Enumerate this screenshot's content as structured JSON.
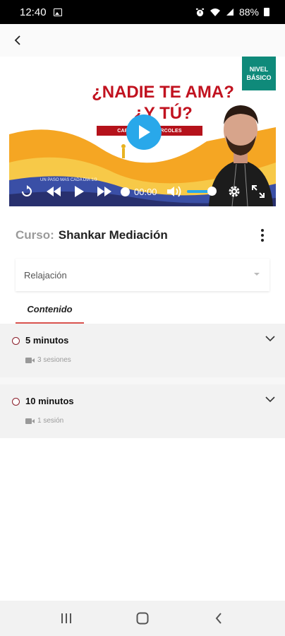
{
  "status": {
    "time": "12:40",
    "battery": "88%",
    "icons": [
      "gallery-icon",
      "alarm-icon",
      "wifi-icon",
      "signal-icon",
      "battery-icon"
    ]
  },
  "video": {
    "badge_line1": "NIVEL",
    "badge_line2": "BÁSICO",
    "title_line1": "¿NADIE TE AMA?",
    "title_line2": "¿Y TÚ?",
    "subtitle": "CAPÍTULO ... MIÉRCOLES",
    "tagline": "UN PASO MÁS CADA DÍA 1/3",
    "time": "00:00",
    "volume": 1.0,
    "colors": {
      "play": "#29a8ea",
      "title": "#c1121f",
      "badge": "#0f8a7a"
    }
  },
  "course": {
    "label": "Curso:",
    "name": "Shankar Mediación"
  },
  "select": {
    "value": "Relajación"
  },
  "tabs": [
    {
      "label": "Contenido",
      "active": true
    }
  ],
  "sections": [
    {
      "title": "5 minutos",
      "sessions": "3 sesiones"
    },
    {
      "title": "10 minutos",
      "sessions": "1 sesión"
    }
  ],
  "colors": {
    "accent": "#d9534f",
    "radio": "#8a1f2b"
  }
}
